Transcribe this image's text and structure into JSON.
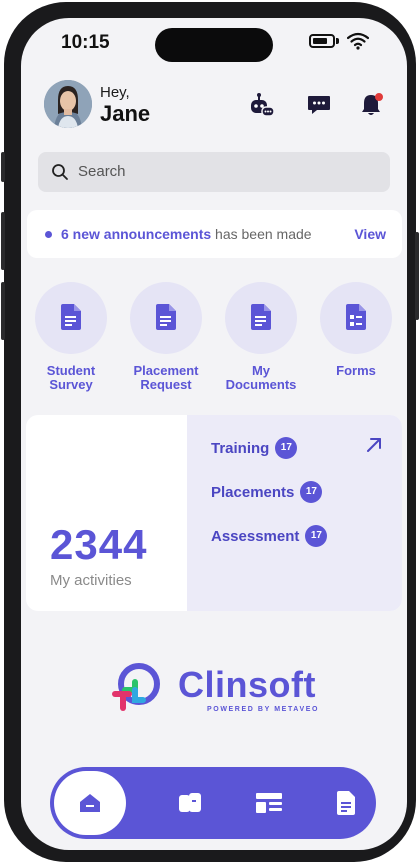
{
  "status_bar": {
    "time": "10:15"
  },
  "header": {
    "greeting": "Hey,",
    "name": "Jane",
    "icons": [
      "robot-assistant-icon",
      "chat-icon",
      "notification-bell-icon"
    ]
  },
  "search": {
    "placeholder": "Search"
  },
  "announcement": {
    "highlight": "6 new announcements",
    "rest": " has been made",
    "action": "View"
  },
  "quick_actions": [
    {
      "line1": "Student",
      "line2": "Survey",
      "icon": "document-icon"
    },
    {
      "line1": "Placement",
      "line2": "Request",
      "icon": "document-icon"
    },
    {
      "line1": "My",
      "line2": "Documents",
      "icon": "document-icon"
    },
    {
      "line1": "Forms",
      "line2": "",
      "icon": "form-icon"
    }
  ],
  "activities": {
    "count": "2344",
    "label": "My activities",
    "items": [
      {
        "label": "Training",
        "badge": "17"
      },
      {
        "label": "Placements",
        "badge": "17"
      },
      {
        "label": "Assessment",
        "badge": "17"
      }
    ]
  },
  "branding": {
    "name": "Clinsoft",
    "tagline": "POWERED BY METAVEO"
  },
  "bottom_nav": [
    "home-icon",
    "wallet-icon",
    "dashboard-icon",
    "document-icon"
  ],
  "colors": {
    "accent": "#5b55d6",
    "accent_light": "#e5e4f5",
    "background": "#f3f3f6"
  }
}
